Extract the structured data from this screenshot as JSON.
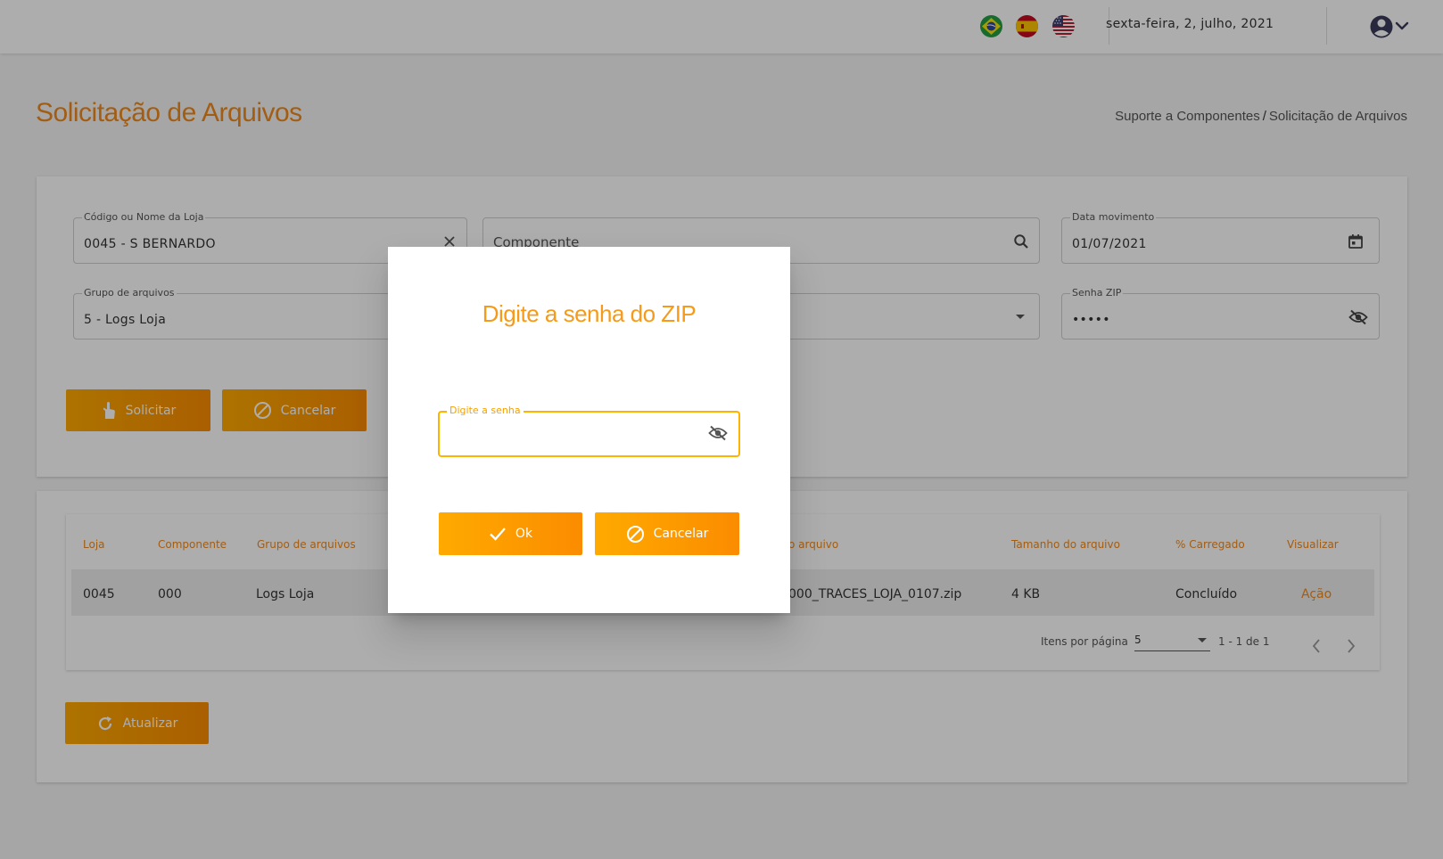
{
  "header": {
    "languages": [
      {
        "name": "brazil-flag"
      },
      {
        "name": "spain-flag"
      },
      {
        "name": "usa-flag"
      }
    ],
    "date": "sexta-feira, 2, julho, 2021",
    "account_icon": "account-circle-icon"
  },
  "page": {
    "title": "Solicitação de Arquivos",
    "breadcrumb": {
      "parent": "Suporte a Componentes",
      "separator": "/",
      "current": "Solicitação de Arquivos"
    }
  },
  "form": {
    "loja": {
      "label": "Código ou Nome da Loja",
      "value": "0045 - S BERNARDO"
    },
    "componente": {
      "placeholder": "Componente"
    },
    "data_movimento": {
      "label": "Data movimento",
      "value": "01/07/2021"
    },
    "grupo": {
      "label": "Grupo de arquivos",
      "value": "5 - Logs Loja"
    },
    "senha_zip": {
      "label": "Senha ZIP",
      "value": "•••••"
    },
    "solicitar_label": "Solicitar",
    "cancelar_label": "Cancelar"
  },
  "table": {
    "columns": {
      "loja": "Loja",
      "componente": "Componente",
      "grupo": "Grupo de arquivos",
      "arquivo": "o arquivo",
      "tamanho": "Tamanho do arquivo",
      "carregado": "% Carregado",
      "visualizar": "Visualizar"
    },
    "rows": [
      {
        "loja": "0045",
        "componente": "000",
        "grupo": "Logs Loja",
        "arquivo": "000_TRACES_LOJA_0107.zip",
        "tamanho": "4 KB",
        "carregado": "Concluído",
        "acao": "Ação"
      }
    ],
    "paginator": {
      "items_label": "Itens por página",
      "page_size": "5",
      "range": "1 - 1 de 1"
    }
  },
  "atualizar_label": "Atualizar",
  "dialog": {
    "title": "Digite a senha do ZIP",
    "password_label": "Digite a senha",
    "ok_label": "Ok",
    "cancel_label": "Cancelar"
  },
  "colors": {
    "accent": "#f08a1c",
    "button_start": "#ffaa00",
    "button_end": "#fb8c00"
  }
}
